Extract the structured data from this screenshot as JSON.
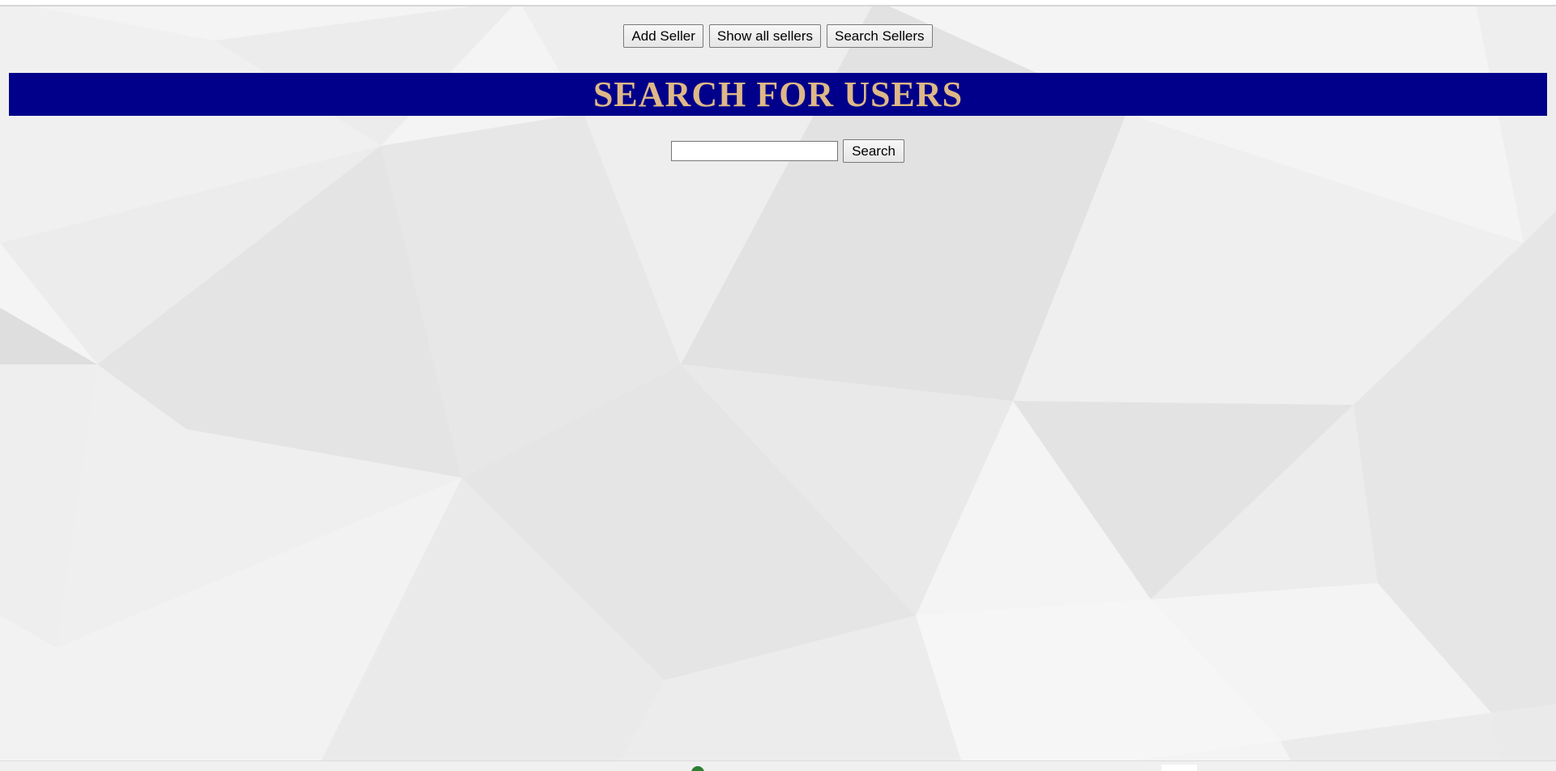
{
  "nav": {
    "add_seller": "Add Seller",
    "show_all_sellers": "Show all sellers",
    "search_sellers": "Search Sellers"
  },
  "banner": {
    "title": "SEARCH FOR USERS",
    "background_color": "#00008b",
    "text_color": "#deb887"
  },
  "search": {
    "input_value": "",
    "button_label": "Search"
  }
}
